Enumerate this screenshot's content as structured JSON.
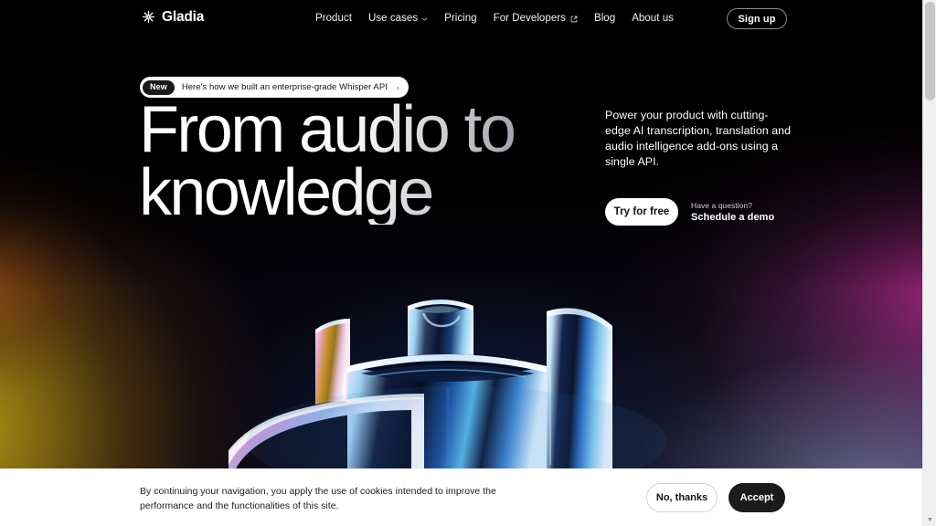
{
  "header": {
    "brand": {
      "name": "Gladia",
      "icon": "snowflake-logo-icon"
    },
    "nav": [
      {
        "label": "Product",
        "icon": null
      },
      {
        "label": "Use cases",
        "icon": "chevron-down-icon"
      },
      {
        "label": "Pricing",
        "icon": null
      },
      {
        "label": "For Developers",
        "icon": "external-link-icon"
      },
      {
        "label": "Blog",
        "icon": null
      },
      {
        "label": "About us",
        "icon": null
      }
    ],
    "signup_label": "Sign up"
  },
  "announcement": {
    "badge": "New",
    "text": "Here's how we built an enterprise-grade Whisper API",
    "arrow": "›"
  },
  "hero": {
    "title_line_1": "From audio to",
    "title_line_2": "knowledge",
    "subtitle": "Power your product with cutting-edge AI transcription, translation and audio intelligence add-ons using a single API.",
    "primary_cta": "Try for free",
    "question_label": "Have a question?",
    "demo_link": "Schedule a demo"
  },
  "cookie": {
    "text": "By continuing your navigation, you apply the use of cookies intended to improve the performance and the functionalities of this site.",
    "decline_label": "No, thanks",
    "accept_label": "Accept"
  },
  "scrollbar": {
    "up_arrow": "▲",
    "down_arrow": "▼"
  },
  "colors": {
    "page_background": "#050208",
    "accent_gold": "#b49a14",
    "accent_magenta": "#af2887",
    "accent_blue": "#737da5",
    "text_primary": "#ffffff",
    "surface_light": "#ffffff",
    "button_dark": "#1b1b1b"
  }
}
